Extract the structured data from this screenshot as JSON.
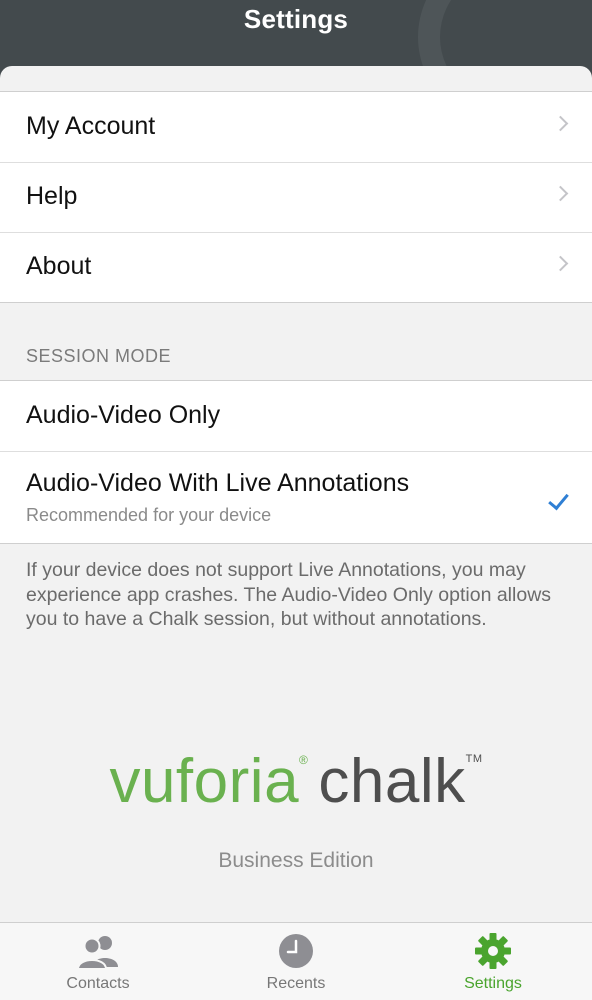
{
  "header": {
    "title": "Settings"
  },
  "menu": [
    {
      "label": "My Account"
    },
    {
      "label": "Help"
    },
    {
      "label": "About"
    }
  ],
  "session_mode": {
    "header": "SESSION MODE",
    "options": [
      {
        "label": "Audio-Video Only",
        "selected": false
      },
      {
        "label": "Audio-Video With Live Annotations",
        "subtitle": "Recommended for your device",
        "selected": true
      }
    ],
    "footnote": "If your device does not support Live Annotations, you may experience app crashes. The Audio-Video Only option allows you to have a Chalk session, but without annotations."
  },
  "branding": {
    "logo_part1": "vuforia",
    "registered": "®",
    "logo_part2": "chalk",
    "trademark": "TM",
    "edition": "Business Edition"
  },
  "tabbar": {
    "tabs": [
      {
        "label": "Contacts",
        "icon": "contacts-icon",
        "active": false
      },
      {
        "label": "Recents",
        "icon": "clock-icon",
        "active": false
      },
      {
        "label": "Settings",
        "icon": "gear-icon",
        "active": true
      }
    ]
  },
  "colors": {
    "accent_green": "#4aa42e",
    "check_blue": "#2f7fd4",
    "header_bg": "#434a4d"
  }
}
